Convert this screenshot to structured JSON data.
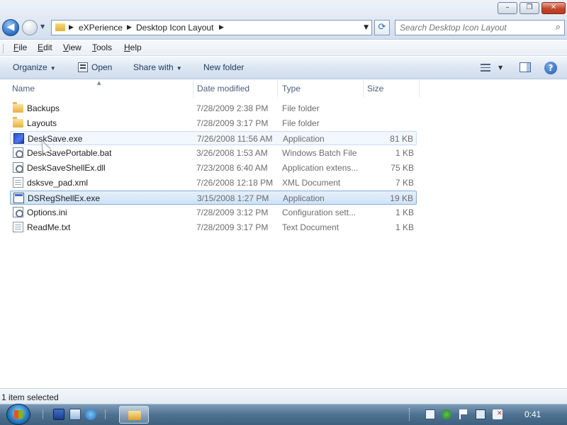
{
  "window": {
    "controls": {
      "minimize": "–",
      "maximize": "❐",
      "close": "✕"
    }
  },
  "address": {
    "breadcrumb": [
      "eXPerience",
      "Desktop Icon Layout"
    ],
    "separator": "▶",
    "dropdown": "▼"
  },
  "search": {
    "placeholder": "Search Desktop Icon Layout",
    "icon": "magnifier-icon"
  },
  "menu": [
    "File",
    "Edit",
    "View",
    "Tools",
    "Help"
  ],
  "toolbar": {
    "organize": "Organize",
    "open": "Open",
    "share_with": "Share with",
    "new_folder": "New folder",
    "caret": "▼",
    "help": "?"
  },
  "columns": {
    "name": "Name",
    "date": "Date modified",
    "type": "Type",
    "size": "Size"
  },
  "files": [
    {
      "name": "Backups",
      "date": "7/28/2009 2:38 PM",
      "type": "File folder",
      "size": "",
      "icon": "folder-icon"
    },
    {
      "name": "Layouts",
      "date": "7/28/2009 3:17 PM",
      "type": "File folder",
      "size": "",
      "icon": "folder-icon"
    },
    {
      "name": "DeskSave.exe",
      "date": "7/26/2008 11:56 AM",
      "type": "Application",
      "size": "81 KB",
      "icon": "application-icon"
    },
    {
      "name": "DeskSavePortable.bat",
      "date": "3/26/2008 1:53 AM",
      "type": "Windows Batch File",
      "size": "1 KB",
      "icon": "batch-file-icon"
    },
    {
      "name": "DeskSaveShellEx.dll",
      "date": "7/23/2008 6:40 AM",
      "type": "Application extens...",
      "size": "75 KB",
      "icon": "dll-icon"
    },
    {
      "name": "dsksve_pad.xml",
      "date": "7/26/2008 12:18 PM",
      "type": "XML Document",
      "size": "7 KB",
      "icon": "xml-icon"
    },
    {
      "name": "DSRegShellEx.exe",
      "date": "3/15/2008 1:27 PM",
      "type": "Application",
      "size": "19 KB",
      "icon": "application-icon"
    },
    {
      "name": "Options.ini",
      "date": "7/28/2009 3:12 PM",
      "type": "Configuration sett...",
      "size": "1 KB",
      "icon": "config-file-icon"
    },
    {
      "name": "ReadMe.txt",
      "date": "7/28/2009 3:17 PM",
      "type": "Text Document",
      "size": "1 KB",
      "icon": "text-file-icon"
    }
  ],
  "status": {
    "text": "1 item selected"
  },
  "taskbar": {
    "clock": "0:41"
  }
}
